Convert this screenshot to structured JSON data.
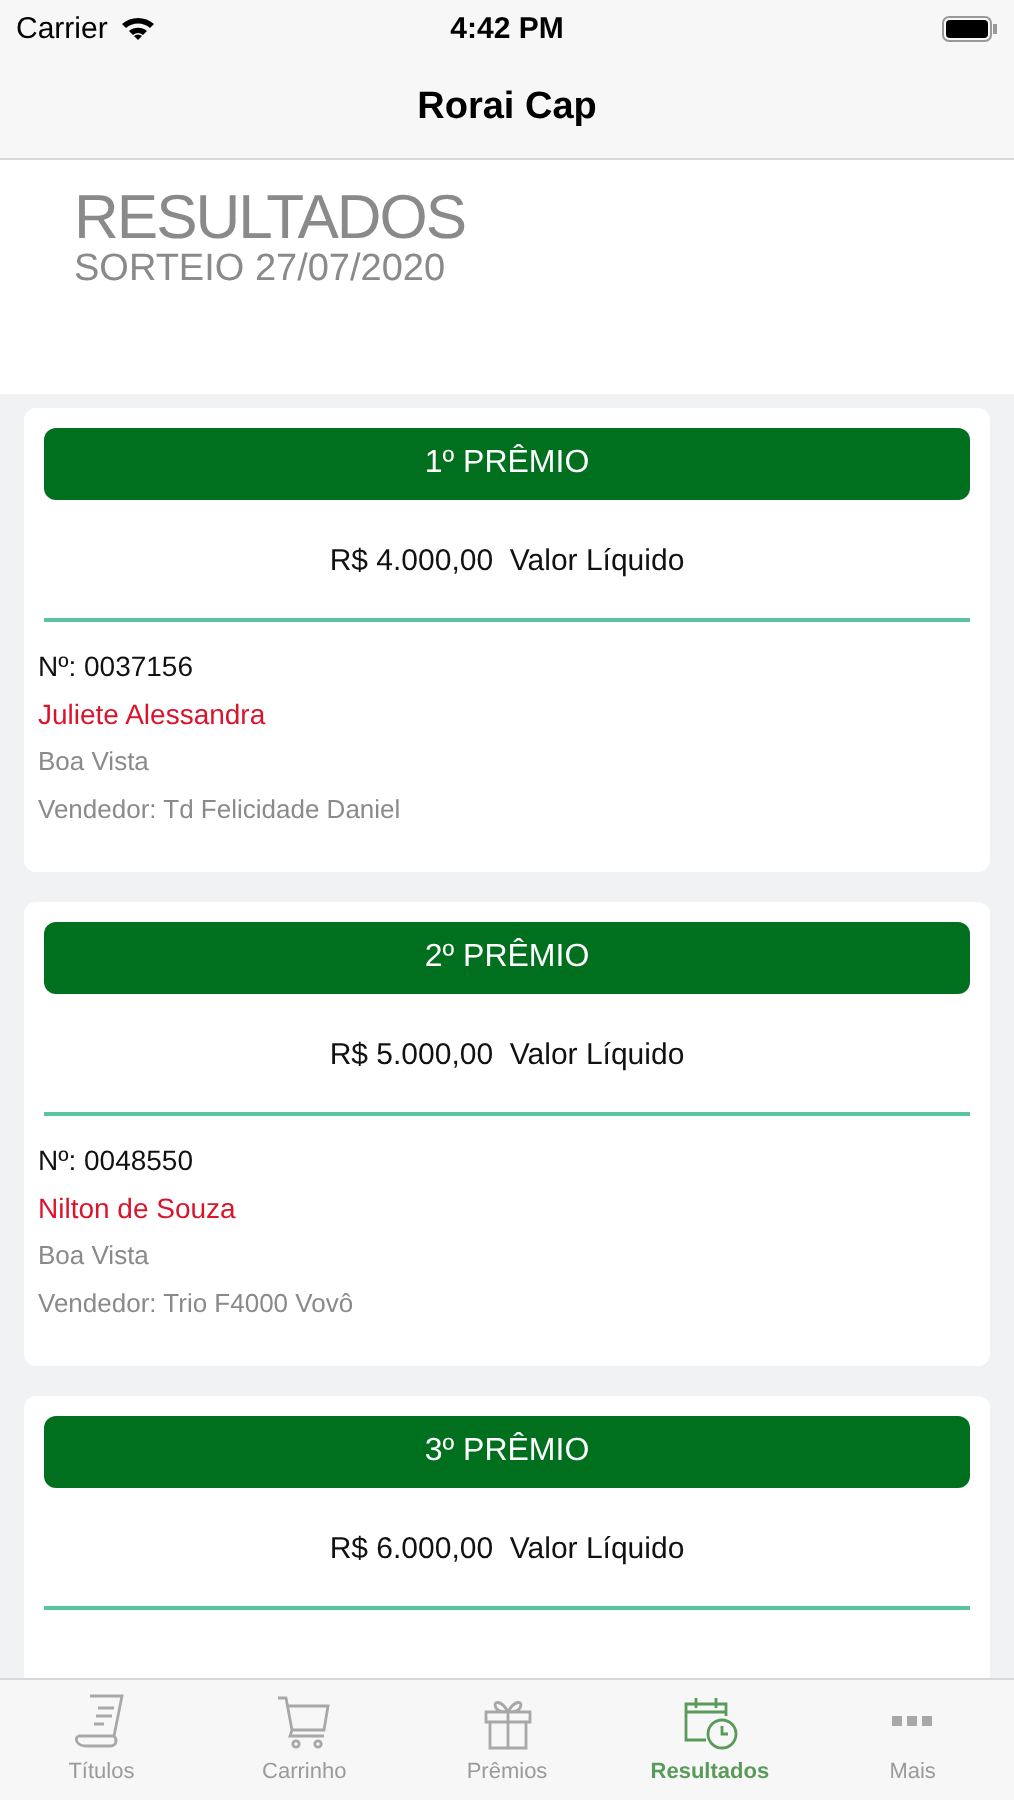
{
  "status_bar": {
    "carrier": "Carrier",
    "time": "4:42 PM"
  },
  "nav_bar": {
    "title": "Rorai Cap"
  },
  "header": {
    "title": "RESULTADOS",
    "subtitle": "SORTEIO 27/07/2020"
  },
  "prizes": [
    {
      "title": "1º PRÊMIO",
      "amount": "R$ 4.000,00  Valor Líquido",
      "number": "Nº: 0037156",
      "winner": "Juliete Alessandra",
      "city": "Boa Vista",
      "seller": "Vendedor: Td Felicidade Daniel"
    },
    {
      "title": "2º PRÊMIO",
      "amount": "R$ 5.000,00  Valor Líquido",
      "number": "Nº: 0048550",
      "winner": "Nilton de Souza",
      "city": "Boa Vista",
      "seller": "Vendedor: Trio F4000 Vovô"
    },
    {
      "title": "3º PRÊMIO",
      "amount": "R$ 6.000,00  Valor Líquido"
    }
  ],
  "tab_bar": [
    {
      "kind": "titles",
      "label": "Títulos",
      "selected": false
    },
    {
      "kind": "cart",
      "label": "Carrinho",
      "selected": false
    },
    {
      "kind": "gift",
      "label": "Prêmios",
      "selected": false
    },
    {
      "kind": "results",
      "label": "Resultados",
      "selected": true
    },
    {
      "kind": "more",
      "label": "Mais",
      "selected": false
    }
  ]
}
